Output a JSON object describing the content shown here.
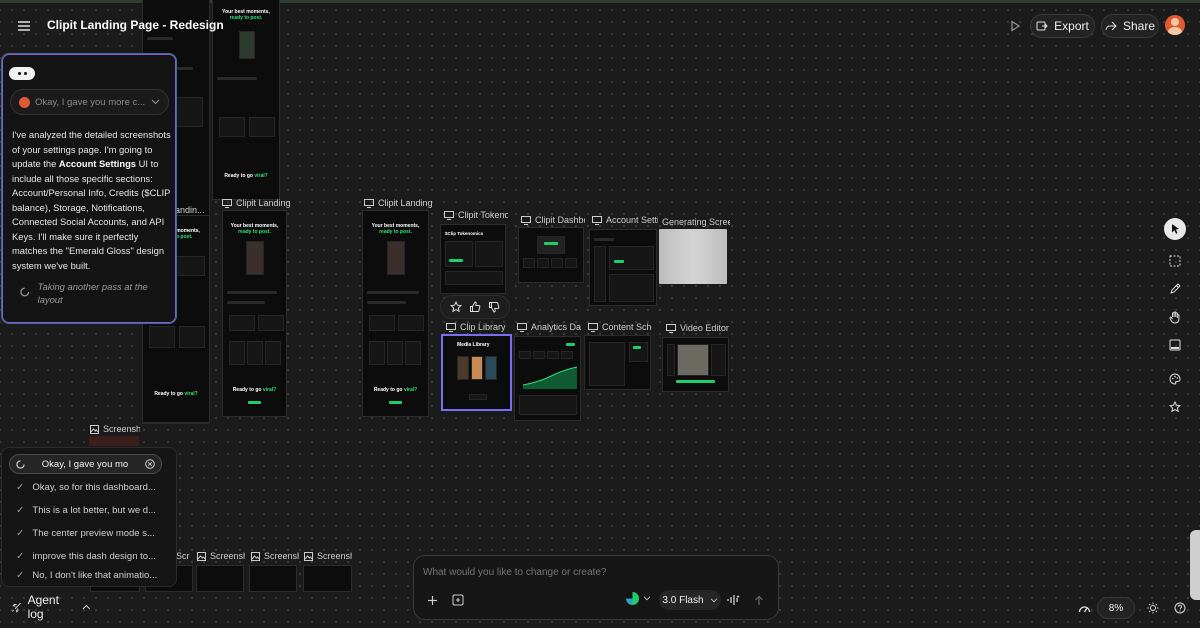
{
  "header": {
    "title": "Clipit Landing Page - Redesign",
    "export_label": "Export",
    "share_label": "Share"
  },
  "chat": {
    "dropdown_text": "Okay, I gave you more c...",
    "message_intro": "I've analyzed the detailed screenshots of your settings page. I'm going to update the ",
    "message_bold": "Account Settings",
    "message_rest": " UI to include all those specific sections: Account/Personal Info, Credits ($CLIP balance), Storage, Notifications, Connected Social Accounts, and API Keys. I'll make sure it perfectly matches the \"Emerald Gloss\" design system we've built.",
    "status": "Taking another pass at the layout"
  },
  "frames": [
    {
      "label": "Clipit Landing ...",
      "id": "landing-2"
    },
    {
      "label": "Clipit Landing ...",
      "id": "landing-3"
    },
    {
      "label": "Clipit Tokeno...",
      "id": "tokenomics"
    },
    {
      "label": "Clipit Dashbo...",
      "id": "dashboard"
    },
    {
      "label": "Account Settin...",
      "id": "account-settings"
    },
    {
      "label": "Generating Screen..",
      "id": "generating"
    },
    {
      "label": "Clip Library",
      "id": "clip-library"
    },
    {
      "label": "Analytics Das...",
      "id": "analytics"
    },
    {
      "label": "Content Sche...",
      "id": "content-schedule"
    },
    {
      "label": "Video Editor",
      "id": "video-editor"
    },
    {
      "label": "Landin...",
      "id": "landing-1"
    },
    {
      "label": "Screensh...",
      "id": "screenshot-1"
    },
    {
      "label": "Screensh...",
      "id": "screenshot-2"
    },
    {
      "label": "Screensh...",
      "id": "screenshot-3"
    },
    {
      "label": "Screensh...",
      "id": "screenshot-4"
    },
    {
      "label": "Screensh...",
      "id": "screenshot-5"
    }
  ],
  "thumb_text": {
    "hero_line1": "Your best moments,",
    "hero_line2": "ready to post.",
    "cta_line1": "Ready to go ",
    "cta_line2": "viral?",
    "tokenomics_title": "$Clip Tokenomics",
    "library_title": "Media Library"
  },
  "agent_log": {
    "active": "Okay, I gave you mo",
    "items": [
      "Okay, so for this dashboard...",
      "This is a lot better, but we d...",
      "The center preview mode s...",
      "improve this dash design to...",
      "No, I don't like that animatio..."
    ],
    "toggle_label": "Agent log"
  },
  "prompt": {
    "placeholder": "What would you like to change or create?",
    "model_label": "3.0 Flash"
  },
  "zoom": {
    "level": "8%"
  },
  "colors": {
    "accent": "#1fd06a",
    "selection": "#7b6cf6",
    "chat_border": "#3b6d9a"
  }
}
